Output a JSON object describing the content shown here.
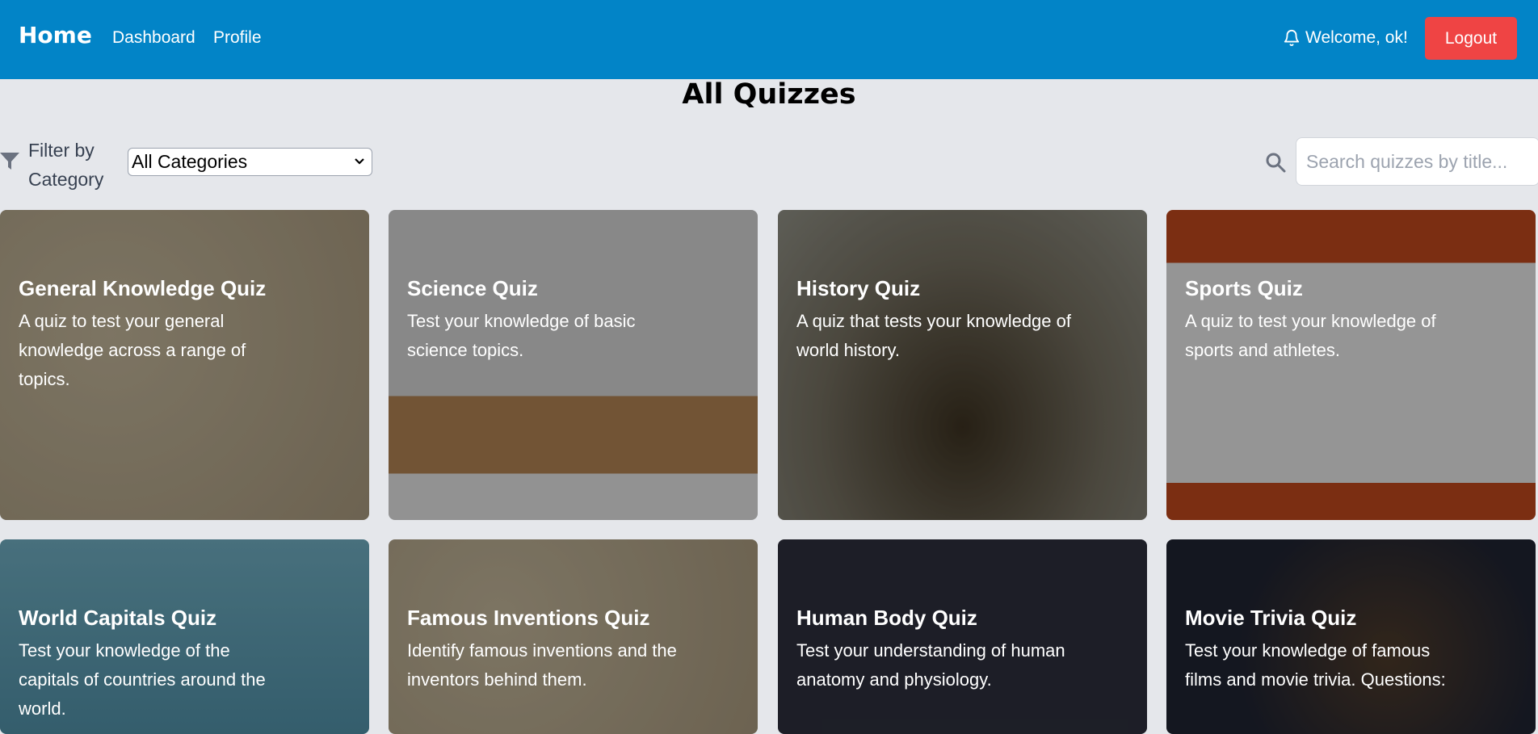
{
  "nav": {
    "home": "Home",
    "links": [
      "Dashboard",
      "Profile"
    ],
    "welcome": "Welcome, ok!",
    "logout": "Logout"
  },
  "page_title": "All Quizzes",
  "filter": {
    "label": "Filter by Category",
    "selected": "All Categories",
    "search_placeholder": "Search quizzes by title..."
  },
  "quizzes": [
    {
      "title": "General Knowledge Quiz",
      "description": "A quiz to test your general knowledge across a range of topics."
    },
    {
      "title": "Science Quiz",
      "description": "Test your knowledge of basic science topics."
    },
    {
      "title": "History Quiz",
      "description": "A quiz that tests your knowledge of world history."
    },
    {
      "title": "Sports Quiz",
      "description": "A quiz to test your knowledge of sports and athletes."
    },
    {
      "title": "World Capitals Quiz",
      "description": "Test your knowledge of the capitals of countries around the world."
    },
    {
      "title": "Famous Inventions Quiz",
      "description": "Identify famous inventions and the inventors behind them."
    },
    {
      "title": "Human Body Quiz",
      "description": "Test your understanding of human anatomy and physiology."
    },
    {
      "title": "Movie Trivia Quiz",
      "description": "Test your knowledge of famous films and movie trivia. Questions:"
    }
  ],
  "colors": {
    "navbar": "#0284c7",
    "logout": "#ef4444",
    "background": "#e5e7eb"
  }
}
